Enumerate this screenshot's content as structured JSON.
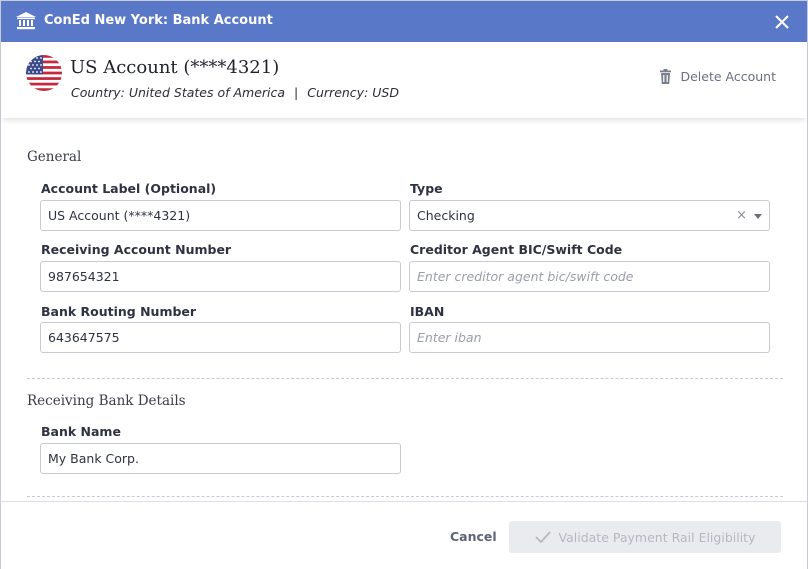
{
  "window": {
    "title": "ConEd New York: Bank Account",
    "title_icon": "bank-icon",
    "close_icon": "close-icon"
  },
  "header": {
    "account_title": "US Account (****4321)",
    "country_text": "Country: United States of America",
    "separator": "|",
    "currency_text": "Currency: USD",
    "flag_icon": "us-flag-icon",
    "delete_label": "Delete Account",
    "delete_icon": "trash-icon"
  },
  "general": {
    "section_title": "General",
    "account_label": {
      "label": "Account Label (Optional)",
      "value": "US Account (****4321)"
    },
    "type": {
      "label": "Type",
      "value": "Checking",
      "clear": "×"
    },
    "receiving_account_number": {
      "label": "Receiving Account Number",
      "value": "987654321"
    },
    "creditor_bic": {
      "label": "Creditor Agent BIC/Swift Code",
      "placeholder": "Enter creditor agent bic/swift code"
    },
    "bank_routing_number": {
      "label": "Bank Routing Number",
      "value": "643647575"
    },
    "iban": {
      "label": "IBAN",
      "placeholder": "Enter iban"
    }
  },
  "receiving_bank": {
    "section_title": "Receiving Bank Details",
    "bank_name": {
      "label": "Bank Name",
      "value": "My Bank Corp."
    }
  },
  "footer": {
    "cancel_label": "Cancel",
    "validate_label": "Validate Payment Rail Eligibility",
    "validate_icon": "check-icon"
  },
  "colors": {
    "titlebar": "#5a78c8",
    "disabled_button_bg": "#e9ebef",
    "disabled_button_text": "#b4b8c2"
  }
}
